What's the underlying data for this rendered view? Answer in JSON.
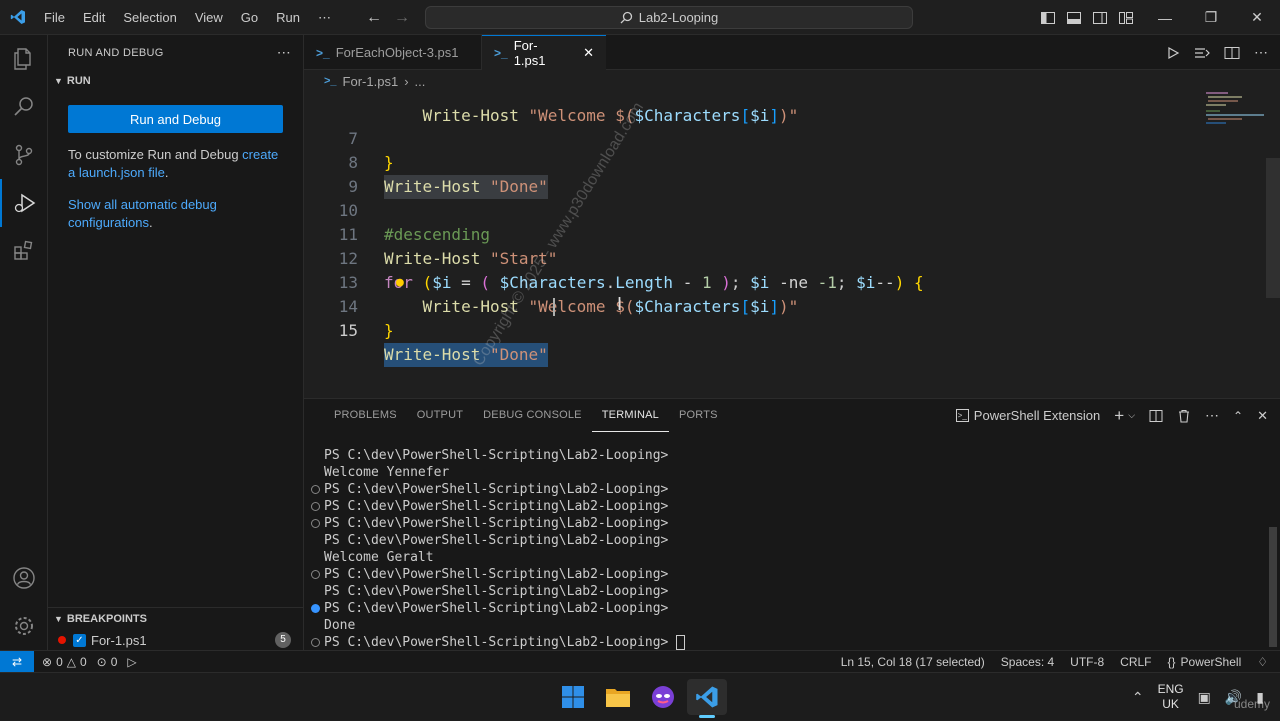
{
  "titlebar": {
    "menu": [
      "File",
      "Edit",
      "Selection",
      "View",
      "Go",
      "Run",
      "⋯"
    ],
    "search_text": "Lab2-Looping"
  },
  "sidebar": {
    "header": "RUN AND DEBUG",
    "run_section": "RUN",
    "run_button": "Run and Debug",
    "customize_text": "To customize Run and Debug ",
    "customize_link": "create a launch.json file",
    "customize_end": ".",
    "show_all_link": "Show all automatic debug configurations",
    "show_all_end": ".",
    "breakpoints_section": "BREAKPOINTS",
    "breakpoint_file": "For-1.ps1",
    "breakpoint_count": "5"
  },
  "tabs": [
    {
      "label": "ForEachObject-3.ps1"
    },
    {
      "label": "For-1.ps1"
    }
  ],
  "breadcrumb": {
    "file": "For-1.ps1",
    "more": "..."
  },
  "editor": {
    "lines": [
      {
        "num": "7"
      },
      {
        "num": "8"
      },
      {
        "num": "9"
      },
      {
        "num": "10"
      },
      {
        "num": "11"
      },
      {
        "num": "12"
      },
      {
        "num": "13"
      },
      {
        "num": "14"
      },
      {
        "num": "15"
      }
    ],
    "partial_line": "    Write-Host \"Welcome $($Characters[$i])\""
  },
  "panel": {
    "tabs": [
      "PROBLEMS",
      "OUTPUT",
      "DEBUG CONSOLE",
      "TERMINAL",
      "PORTS"
    ],
    "active_tab": "TERMINAL",
    "shell_label": "PowerShell Extension",
    "terminal_lines": [
      {
        "text": "PS C:\\dev\\PowerShell-Scripting\\Lab2-Looping>",
        "deco": "none"
      },
      {
        "text": "Welcome Yennefer",
        "deco": "none"
      },
      {
        "text": "PS C:\\dev\\PowerShell-Scripting\\Lab2-Looping>",
        "deco": "empty"
      },
      {
        "text": "PS C:\\dev\\PowerShell-Scripting\\Lab2-Looping>",
        "deco": "empty"
      },
      {
        "text": "PS C:\\dev\\PowerShell-Scripting\\Lab2-Looping>",
        "deco": "empty"
      },
      {
        "text": "PS C:\\dev\\PowerShell-Scripting\\Lab2-Looping>",
        "deco": "none"
      },
      {
        "text": "Welcome Geralt",
        "deco": "none"
      },
      {
        "text": "PS C:\\dev\\PowerShell-Scripting\\Lab2-Looping>",
        "deco": "empty"
      },
      {
        "text": "PS C:\\dev\\PowerShell-Scripting\\Lab2-Looping>",
        "deco": "none"
      },
      {
        "text": "PS C:\\dev\\PowerShell-Scripting\\Lab2-Looping>",
        "deco": "blue"
      },
      {
        "text": "Done",
        "deco": "none"
      },
      {
        "text": "PS C:\\dev\\PowerShell-Scripting\\Lab2-Looping> ",
        "deco": "empty"
      }
    ]
  },
  "statusbar": {
    "errors": "0",
    "warnings": "0",
    "ports": "0",
    "position": "Ln 15, Col 18 (17 selected)",
    "spaces": "Spaces: 4",
    "encoding": "UTF-8",
    "eol": "CRLF",
    "language": "PowerShell"
  },
  "taskbar": {
    "lang_line1": "ENG",
    "lang_line2": "UK"
  },
  "watermark": "Copyright © 2025 - www.p30download.com",
  "udemy_mark": "udemy",
  "colors": {
    "accent": "#0078d4",
    "background": "#1f1f1f",
    "sidebar": "#181818",
    "selection": "#264f78",
    "breakpoint": "#e51400"
  }
}
